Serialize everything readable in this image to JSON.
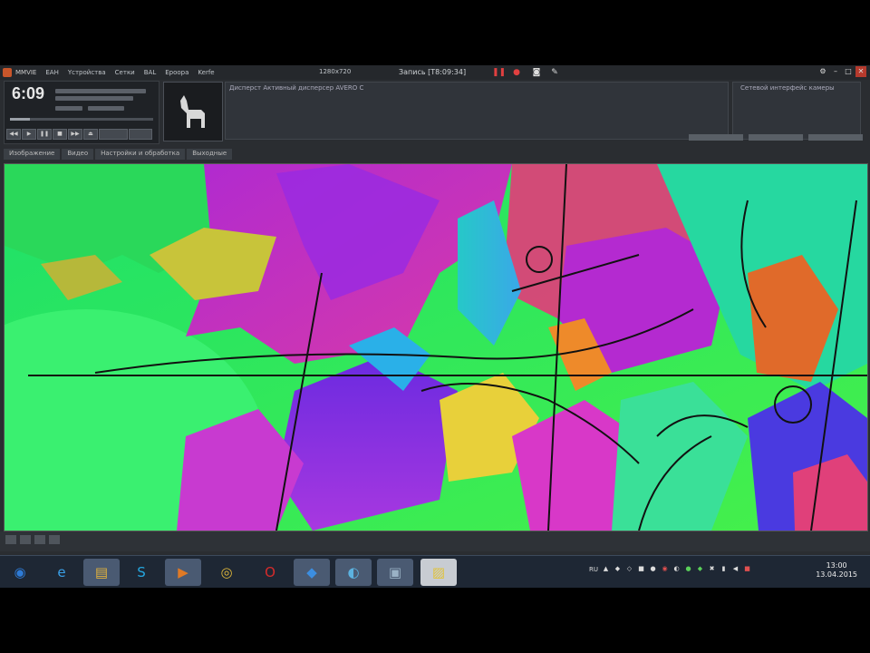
{
  "menubar": {
    "items": [
      "MMVIE",
      "EAH",
      "Yстройства",
      "Сетки",
      "BAL",
      "Epoopa",
      "Kerfe"
    ],
    "center_label": "1280x720",
    "title": "Запись [Т8:09:34]"
  },
  "player": {
    "time": "6:09"
  },
  "toolbar": {
    "label": "Дисперст    Активный дисперсер AVERO C"
  },
  "right_panel": {
    "label": "Сетевой интерфейс камеры"
  },
  "tabs": [
    "Изображение",
    "Видео",
    "Настройки и обработка",
    "Выходные"
  ],
  "taskbar": {
    "apps": [
      {
        "name": "start",
        "glyph": "◉",
        "color": "#2e7bd6"
      },
      {
        "name": "ie",
        "glyph": "e",
        "color": "#3aa0e8"
      },
      {
        "name": "explorer",
        "glyph": "▤",
        "color": "#e3b23c"
      },
      {
        "name": "skype",
        "glyph": "S",
        "color": "#25a7e0"
      },
      {
        "name": "media",
        "glyph": "▶",
        "color": "#e07a25"
      },
      {
        "name": "chrome",
        "glyph": "◎",
        "color": "#e0b83a"
      },
      {
        "name": "opera",
        "glyph": "O",
        "color": "#d62b2b"
      },
      {
        "name": "cloud",
        "glyph": "◆",
        "color": "#3c8ee0"
      },
      {
        "name": "vpn",
        "glyph": "◐",
        "color": "#5cb2e0"
      },
      {
        "name": "photo",
        "glyph": "▣",
        "color": "#9ab2c6"
      },
      {
        "name": "recorder",
        "glyph": "▨",
        "color": "#e0c23a"
      }
    ],
    "tray_label": "RU",
    "clock_time": "13:00",
    "clock_date": "13.04.2015"
  }
}
